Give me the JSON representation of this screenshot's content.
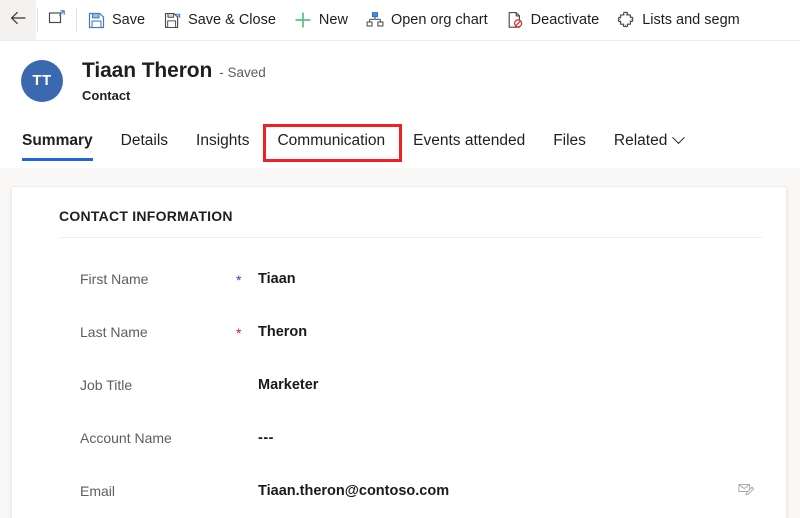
{
  "commandbar": {
    "back_icon": "back-arrow-icon",
    "popout_icon": "open-in-new-window-icon",
    "buttons": [
      {
        "label": "Save",
        "icon": "save-floppy-icon"
      },
      {
        "label": "Save & Close",
        "icon": "save-and-close-icon"
      },
      {
        "label": "New",
        "icon": "plus-icon"
      },
      {
        "label": "Open org chart",
        "icon": "org-chart-icon"
      },
      {
        "label": "Deactivate",
        "icon": "deactivate-icon"
      },
      {
        "label": "Lists and segm",
        "icon": "lists-and-segments-icon"
      }
    ]
  },
  "record": {
    "avatar_initials": "TT",
    "name": "Tiaan Theron",
    "status": "- Saved",
    "entity": "Contact"
  },
  "tabs": [
    {
      "label": "Summary",
      "active": true,
      "has_chevron": false,
      "annotated": false
    },
    {
      "label": "Details",
      "active": false,
      "has_chevron": false,
      "annotated": false
    },
    {
      "label": "Insights",
      "active": false,
      "has_chevron": false,
      "annotated": false
    },
    {
      "label": "Communication",
      "active": false,
      "has_chevron": false,
      "annotated": true
    },
    {
      "label": "Events attended",
      "active": false,
      "has_chevron": false,
      "annotated": false
    },
    {
      "label": "Files",
      "active": false,
      "has_chevron": false,
      "annotated": false
    },
    {
      "label": "Related",
      "active": false,
      "has_chevron": true,
      "annotated": false
    }
  ],
  "card": {
    "title": "CONTACT INFORMATION",
    "fields": [
      {
        "label": "First Name",
        "marker": "recommended",
        "value": "Tiaan",
        "action_icon": null
      },
      {
        "label": "Last Name",
        "marker": "required",
        "value": "Theron",
        "action_icon": null
      },
      {
        "label": "Job Title",
        "marker": "none",
        "value": "Marketer",
        "action_icon": null
      },
      {
        "label": "Account Name",
        "marker": "none",
        "value": "---",
        "action_icon": null
      },
      {
        "label": "Email",
        "marker": "none",
        "value": "Tiaan.theron@contoso.com",
        "action_icon": "email-envelope-icon"
      }
    ]
  },
  "colors": {
    "accent_blue": "#2266dd",
    "avatar_blue": "#3a69b0",
    "required_red": "#e81123",
    "recommended_blue": "#2b42d6",
    "annotation_red": "#ee2222",
    "page_background": "#faf9f8"
  }
}
